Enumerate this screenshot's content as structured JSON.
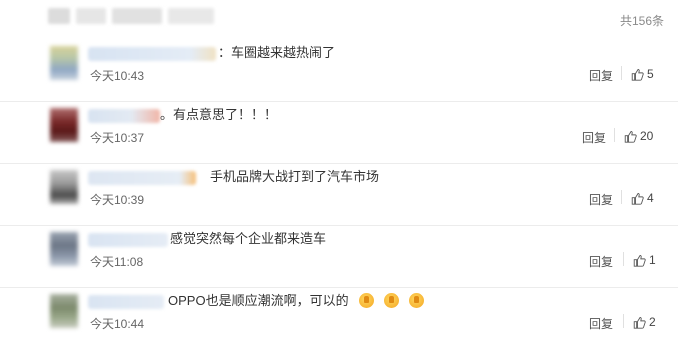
{
  "header": {
    "total": "共156条"
  },
  "comments": [
    {
      "text": "：车圈越来越热闹了",
      "time": "今天10:43",
      "reply": "回复",
      "likes": "5"
    },
    {
      "text": "。有点意思了！！！",
      "time": "今天10:37",
      "reply": "回复",
      "likes": "20"
    },
    {
      "text": "手机品牌大战打到了汽车市场",
      "time": "今天10:39",
      "reply": "回复",
      "likes": "4"
    },
    {
      "text": "感觉突然每个企业都来造车",
      "time": "今天11:08",
      "reply": "回复",
      "likes": "1"
    },
    {
      "text": "OPPO也是顺应潮流啊，可以的",
      "time": "今天10:44",
      "reply": "回复",
      "likes": "2"
    }
  ],
  "icons": {
    "like": "thumbs-up-icon",
    "emoji": "thumbs-up-emoji-icon"
  },
  "colors": {
    "text": "#333333",
    "meta": "#666666",
    "divider": "#ececec"
  }
}
